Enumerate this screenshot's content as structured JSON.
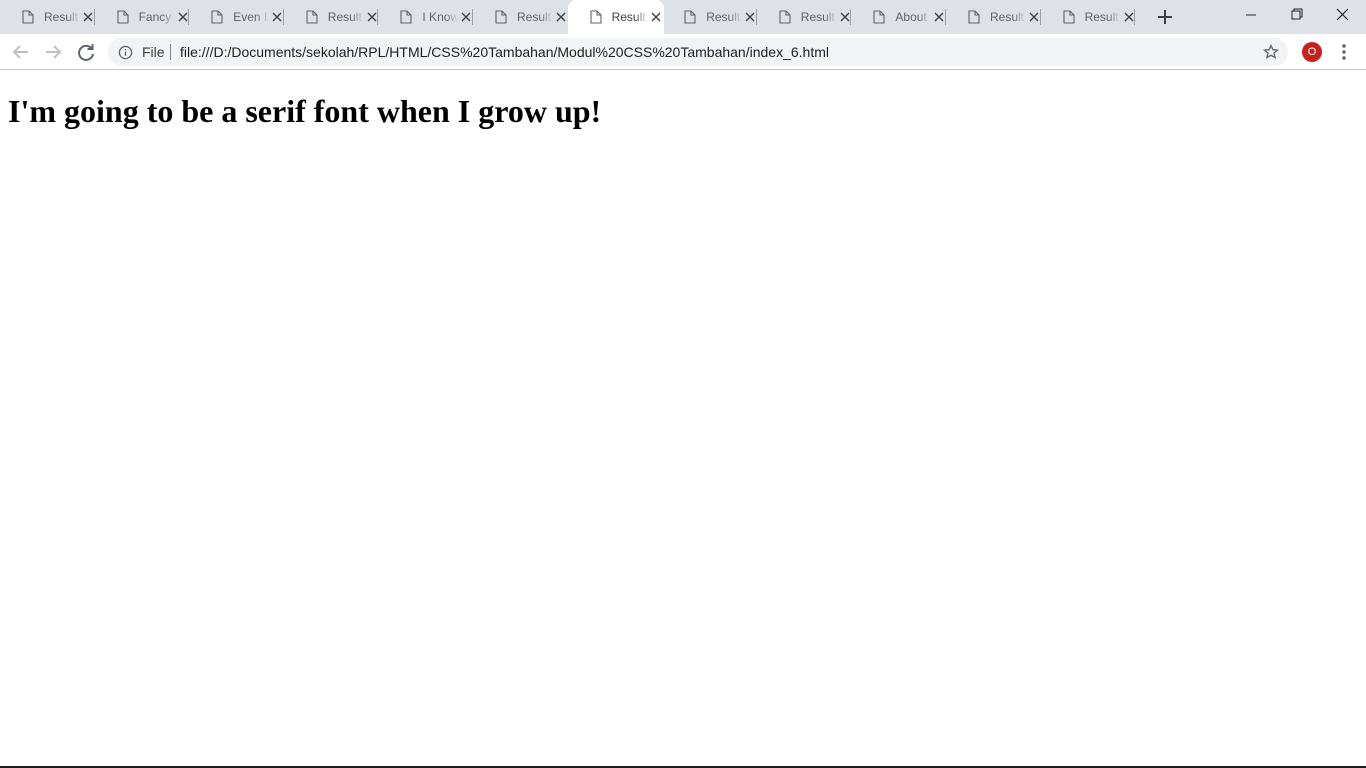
{
  "browser": {
    "tabs": [
      {
        "title": "Result",
        "active": false
      },
      {
        "title": "Fancy",
        "active": false
      },
      {
        "title": "Even I",
        "active": false
      },
      {
        "title": "Result",
        "active": false
      },
      {
        "title": "I Know",
        "active": false
      },
      {
        "title": "Result",
        "active": false
      },
      {
        "title": "Result",
        "active": true
      },
      {
        "title": "Result",
        "active": false
      },
      {
        "title": "Result",
        "active": false
      },
      {
        "title": "About",
        "active": false
      },
      {
        "title": "Result",
        "active": false
      },
      {
        "title": "Result",
        "active": false
      }
    ],
    "address_bar": {
      "scheme_label": "File",
      "url": "file:///D:/Documents/sekolah/RPL/HTML/CSS%20Tambahan/Modul%20CSS%20Tambahan/index_6.html"
    },
    "profile": {
      "initial": "O",
      "color": "#c5221f"
    }
  },
  "page": {
    "heading": "I'm going to be a serif font when I grow up!"
  },
  "icons": {
    "tab": "document-icon",
    "tab_close": "close-icon",
    "new_tab": "plus-icon",
    "back": "back-arrow-icon",
    "forward": "forward-arrow-icon",
    "reload": "reload-icon",
    "site_info": "info-icon",
    "bookmark": "star-icon",
    "menu": "more-vertical-icon"
  }
}
